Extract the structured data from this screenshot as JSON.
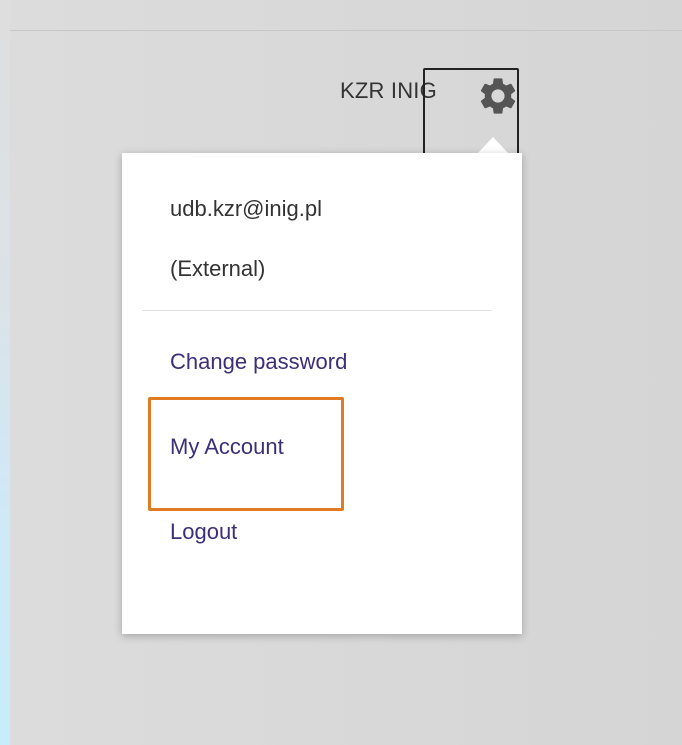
{
  "header": {
    "user_name": "KZR INIG",
    "settings_icon": "gear-icon"
  },
  "user_menu": {
    "email": "udb.kzr@inig.pl",
    "account_type": "(External)",
    "items": [
      {
        "label": "Change password"
      },
      {
        "label": "My Account"
      },
      {
        "label": "Logout"
      }
    ]
  },
  "colors": {
    "link": "#3b2f78",
    "highlight": "#e07b24",
    "text": "#333333",
    "background": "#d9d9d9"
  }
}
